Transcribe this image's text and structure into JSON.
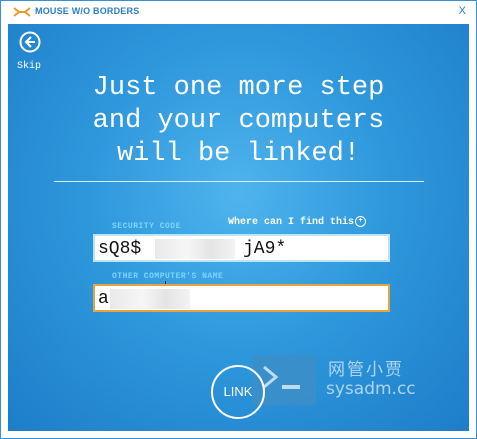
{
  "window": {
    "title": "MOUSE W/O BORDERS",
    "close": "X"
  },
  "back": {
    "label": "Skip"
  },
  "headline": "Just one more step\nand your computers\nwill be linked!",
  "security": {
    "label": "SECURITY CODE",
    "help": "Where can I find this",
    "value_start": "sQ8$",
    "value_end": "jA9*"
  },
  "other": {
    "label": "OTHER COMPUTER'S NAME",
    "value_start": "a"
  },
  "link": {
    "label": "LINK"
  },
  "watermark": {
    "cn": "网管小贾",
    "en": "sysadm.cc"
  },
  "colors": {
    "accent": "#2f98dc",
    "focus_border": "#e8a33a"
  }
}
